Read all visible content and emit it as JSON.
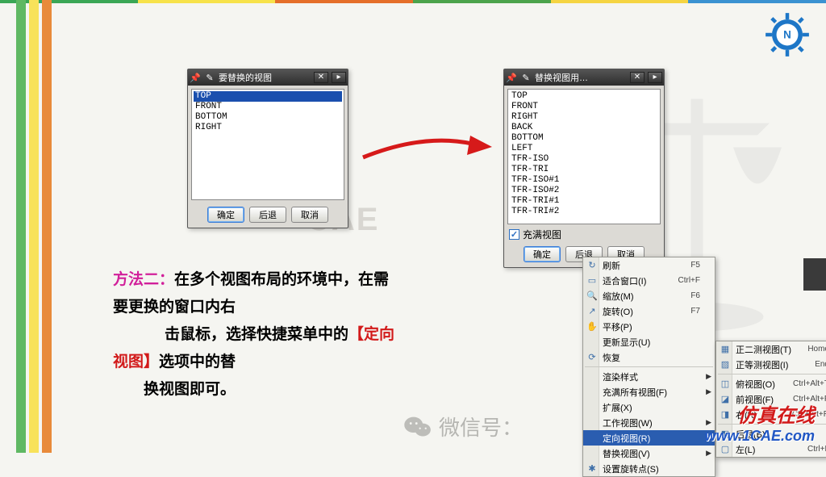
{
  "dialog1": {
    "title": "要替换的视图",
    "items": [
      "TOP",
      "FRONT",
      "BOTTOM",
      "RIGHT"
    ],
    "selected_index": 0,
    "ok": "确定",
    "back": "后退",
    "cancel": "取消"
  },
  "dialog2": {
    "title": "替换视图用…",
    "items": [
      "TOP",
      "FRONT",
      "RIGHT",
      "BACK",
      "BOTTOM",
      "LEFT",
      "TFR-ISO",
      "TFR-TRI",
      "TFR-ISO#1",
      "TFR-ISO#2",
      "TFR-TRI#1",
      "TFR-TRI#2"
    ],
    "fill_label": "充满视图",
    "fill_checked": true,
    "ok": "确定",
    "back": "后退",
    "cancel": "取消"
  },
  "watermark_text": "CAE",
  "instruction": {
    "prefix": "方法二：",
    "line1_rest": "在多个视图布局的环境中，在需",
    "line2": "要更换的窗口内右",
    "line3_a": "击鼠标，选择快捷菜单中的",
    "line3_b": "【定向",
    "line4_a": "视图】",
    "line4_b": "选项中的替",
    "line5": "换视图即可。"
  },
  "context_menu": {
    "items": [
      {
        "icon": "↻",
        "label": "刷新",
        "shortcut": "F5"
      },
      {
        "icon": "▭",
        "label": "适合窗口(I)",
        "shortcut": "Ctrl+F"
      },
      {
        "icon": "🔍",
        "label": "缩放(M)",
        "shortcut": "F6"
      },
      {
        "icon": "↗",
        "label": "旋转(O)",
        "shortcut": "F7"
      },
      {
        "icon": "✋",
        "label": "平移(P)",
        "shortcut": ""
      },
      {
        "icon": "",
        "label": "更新显示(U)",
        "shortcut": ""
      },
      {
        "icon": "⟳",
        "label": "恢复",
        "shortcut": ""
      }
    ],
    "items2": [
      {
        "icon": "",
        "label": "渲染样式",
        "submenu": true
      },
      {
        "icon": "",
        "label": "充满所有视图(F)",
        "submenu": true
      },
      {
        "icon": "",
        "label": "扩展(X)",
        "submenu": false
      },
      {
        "icon": "",
        "label": "工作视图(W)",
        "submenu": true
      },
      {
        "icon": "",
        "label": "定向视图(R)",
        "submenu": true
      },
      {
        "icon": "",
        "label": "替换视图(V)",
        "submenu": true
      },
      {
        "icon": "✱",
        "label": "设置旋转点(S)",
        "submenu": false
      }
    ],
    "selected_label": "定向视图(R)"
  },
  "submenu": {
    "items": [
      {
        "icon": "▦",
        "label": "正二测视图(T)",
        "shortcut": "Home"
      },
      {
        "icon": "▨",
        "label": "正等测视图(I)",
        "shortcut": "End"
      },
      {
        "sep": true
      },
      {
        "icon": "◫",
        "label": "俯视图(O)",
        "shortcut": "Ctrl+Alt+T"
      },
      {
        "icon": "◪",
        "label": "前视图(F)",
        "shortcut": "Ctrl+Alt+F"
      },
      {
        "icon": "◨",
        "label": "右(R)",
        "shortcut": "Ctrl+Alt+R"
      },
      {
        "sep": true
      },
      {
        "icon": "◧",
        "label": "后退(B)",
        "shortcut": ""
      },
      {
        "icon": "▢",
        "label": "左(L)",
        "shortcut": "Ctrl+L"
      }
    ]
  },
  "footer": {
    "wx_label": "微信号：",
    "brand_zh": "仿真在线",
    "brand_en": "www.1CAE.com"
  }
}
